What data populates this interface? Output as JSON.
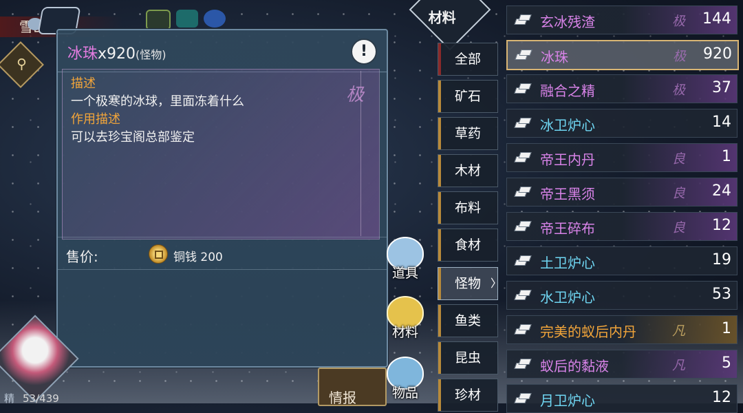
{
  "location": {
    "name": "雪山寒径"
  },
  "detail": {
    "item_name": "冰珠",
    "quantity": "x920",
    "category": "(怪物)",
    "rank_mark": "极",
    "desc_label": "描述",
    "desc_text": "一个极寒的冰球，里面冻着什么",
    "use_label": "作用描述",
    "use_text": "可以去珍宝阁总部鉴定",
    "price_label": "售价:",
    "price_value": "铜钱 200",
    "info_icon": "info-icon"
  },
  "bags": [
    {
      "label": "道具",
      "icon": "bag-icon"
    },
    {
      "label": "材料",
      "icon": "gold-bag-icon"
    },
    {
      "label": "物品",
      "icon": "bag-icon"
    }
  ],
  "subcat_title": "材料",
  "tabs": [
    {
      "label": "全部"
    },
    {
      "label": "矿石"
    },
    {
      "label": "草药"
    },
    {
      "label": "木材"
    },
    {
      "label": "布料"
    },
    {
      "label": "食材"
    },
    {
      "label": "怪物",
      "active": true
    },
    {
      "label": "鱼类"
    },
    {
      "label": "昆虫"
    },
    {
      "label": "珍材"
    }
  ],
  "items": [
    {
      "name": "玄冰残渣",
      "grade": "极",
      "count": "144",
      "color": "purple"
    },
    {
      "name": "冰珠",
      "grade": "极",
      "count": "920",
      "color": "purple",
      "selected": true
    },
    {
      "name": "融合之精",
      "grade": "极",
      "count": "37",
      "color": "purple"
    },
    {
      "name": "冰卫炉心",
      "grade": "",
      "count": "14",
      "color": "blue"
    },
    {
      "name": "帝王内丹",
      "grade": "良",
      "count": "1",
      "color": "purple"
    },
    {
      "name": "帝王黑须",
      "grade": "良",
      "count": "24",
      "color": "purple"
    },
    {
      "name": "帝王碎布",
      "grade": "良",
      "count": "12",
      "color": "purple"
    },
    {
      "name": "土卫炉心",
      "grade": "",
      "count": "19",
      "color": "blue"
    },
    {
      "name": "水卫炉心",
      "grade": "",
      "count": "53",
      "color": "blue"
    },
    {
      "name": "完美的蚁后内丹",
      "grade": "凡",
      "count": "1",
      "color": "orange"
    },
    {
      "name": "蚁后的黏液",
      "grade": "凡",
      "count": "5",
      "color": "purple"
    },
    {
      "name": "月卫炉心",
      "grade": "",
      "count": "12",
      "color": "blue"
    }
  ],
  "player": {
    "stamina_label": "精",
    "stamina_value": "53/439"
  },
  "intel_button": {
    "label": "情报"
  }
}
